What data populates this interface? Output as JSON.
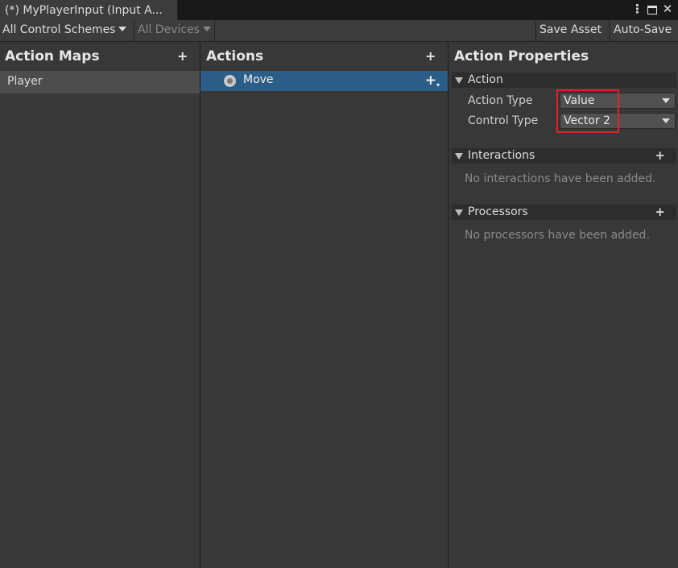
{
  "window": {
    "tab_title": "(*) MyPlayerInput (Input A...",
    "icons": [
      "more-icon",
      "maximize-icon",
      "close-icon"
    ]
  },
  "toolbar": {
    "control_scheme": "All Control Schemes",
    "devices": "All Devices",
    "save_label": "Save Asset",
    "autosave_label": "Auto-Save"
  },
  "action_maps": {
    "title": "Action Maps",
    "add": "+",
    "items": [
      {
        "label": "Player"
      }
    ]
  },
  "actions": {
    "title": "Actions",
    "add": "+",
    "items": [
      {
        "label": "Move"
      }
    ]
  },
  "properties": {
    "title": "Action Properties",
    "action_section": {
      "title": "Action",
      "action_type_label": "Action Type",
      "action_type_value": "Value",
      "control_type_label": "Control Type",
      "control_type_value": "Vector 2"
    },
    "interactions": {
      "title": "Interactions",
      "add": "+",
      "empty": "No interactions have been added."
    },
    "processors": {
      "title": "Processors",
      "add": "+",
      "empty": "No processors have been added."
    }
  },
  "colors": {
    "selection": "#2c5d87",
    "highlight_box": "#e2202a",
    "background": "#383838"
  }
}
